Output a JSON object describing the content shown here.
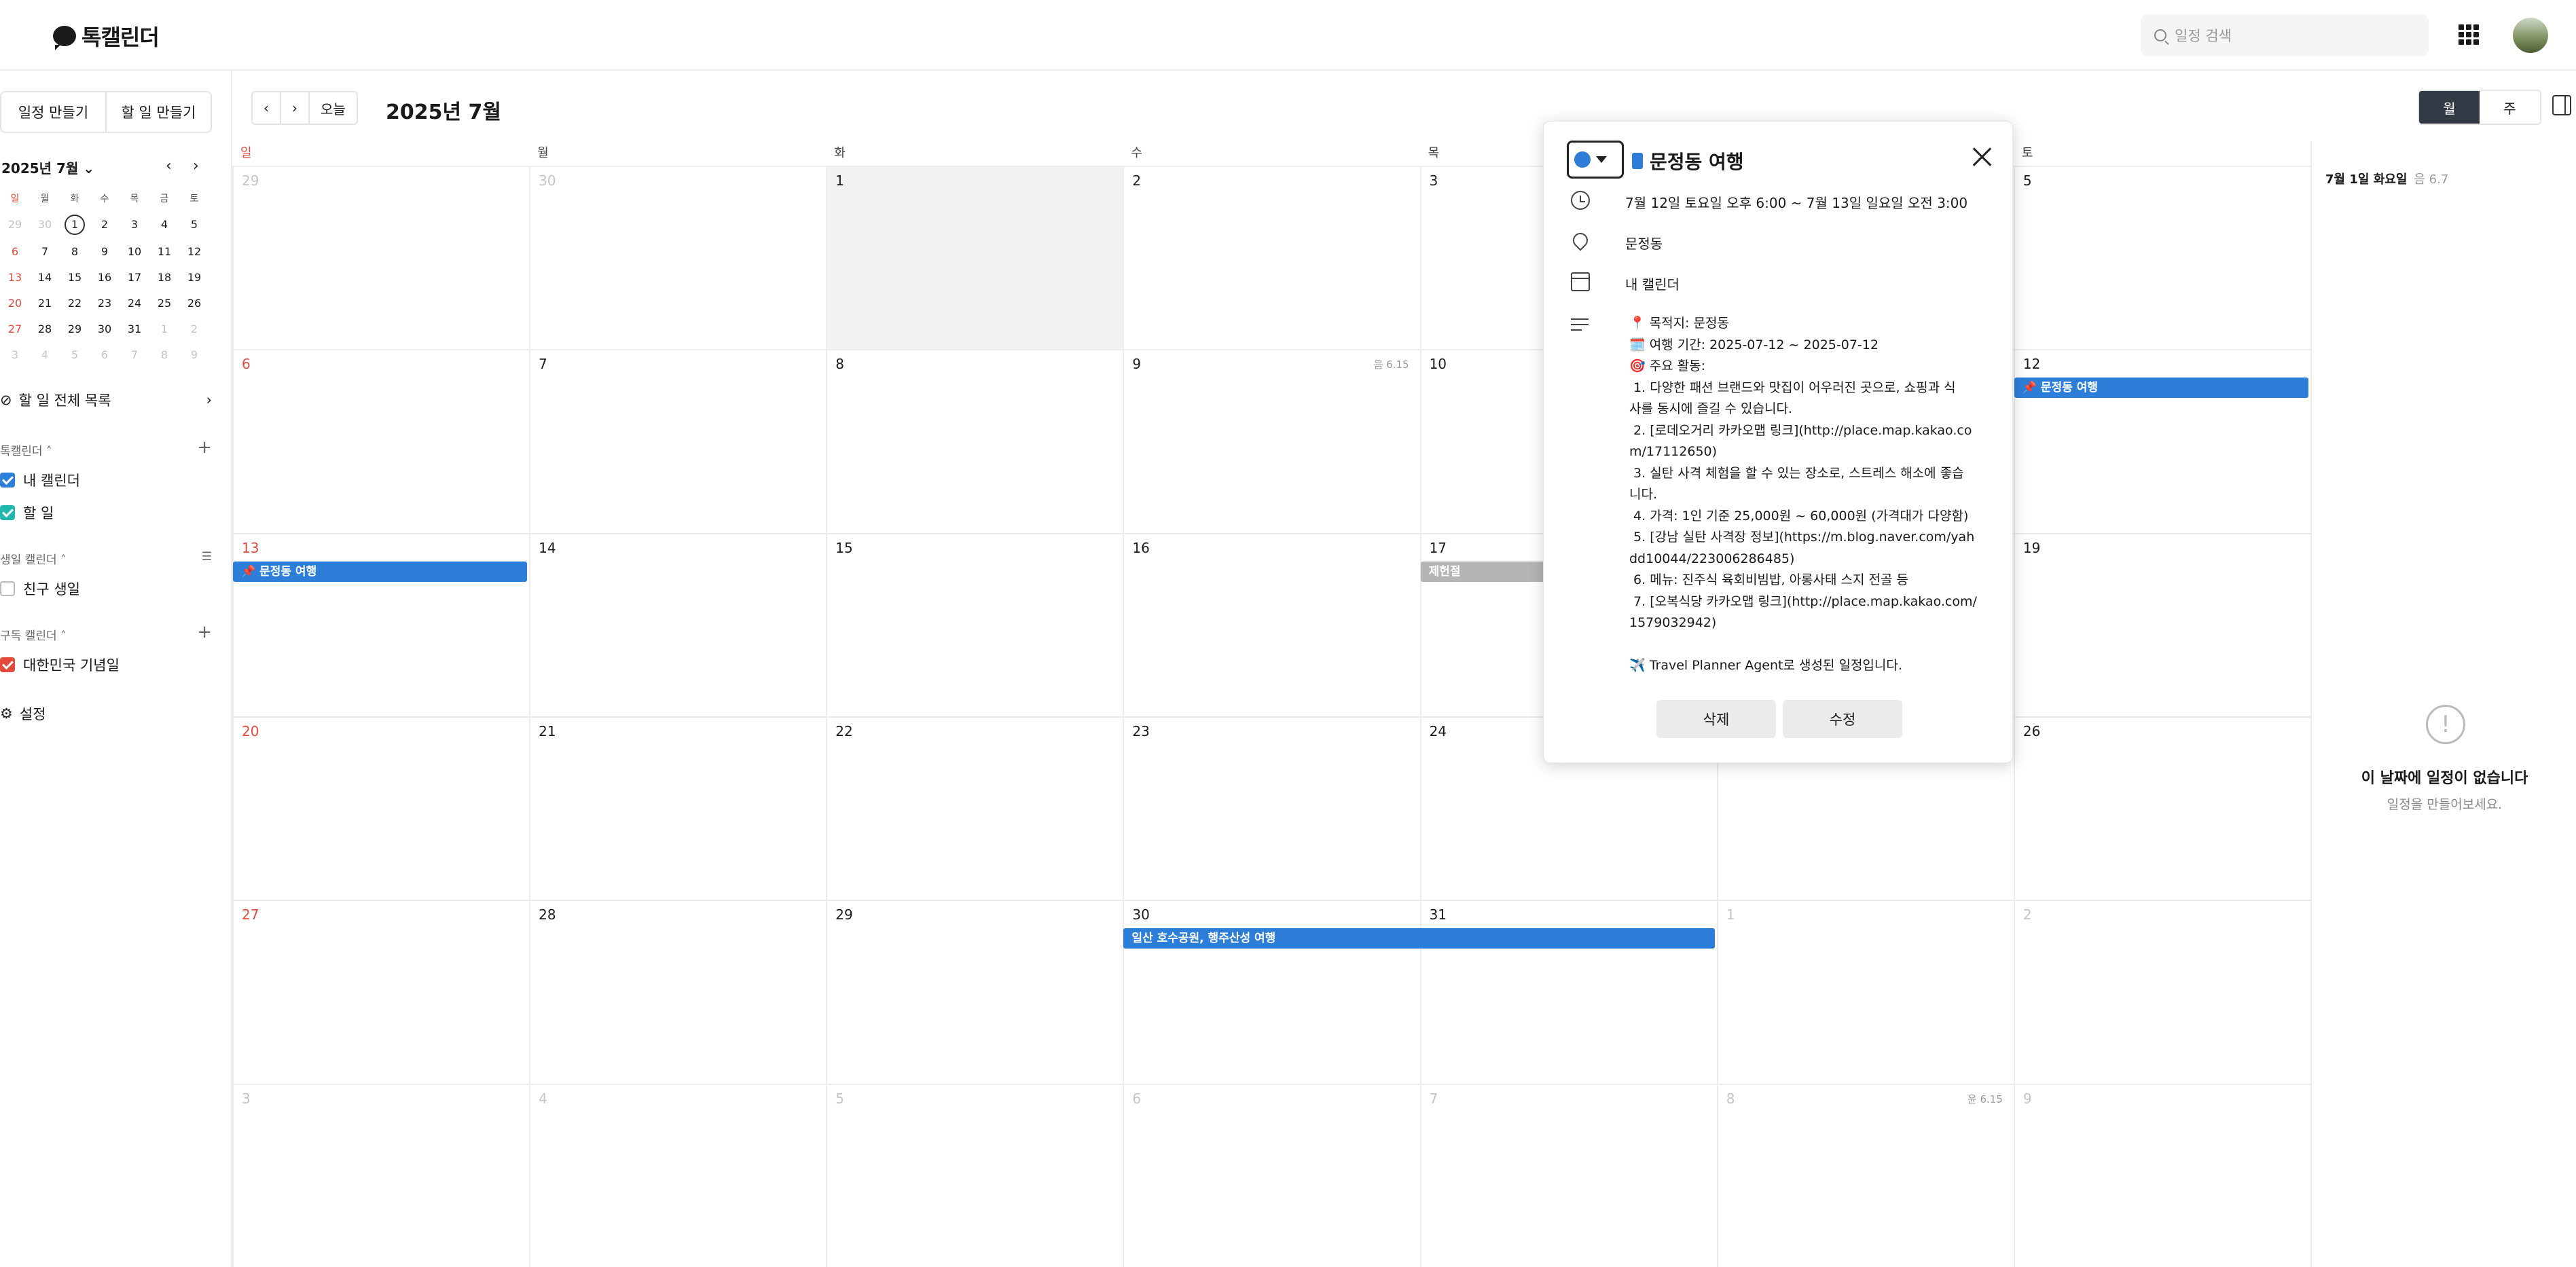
{
  "app": {
    "title": "톡캘린더"
  },
  "search": {
    "placeholder": "일정 검색"
  },
  "sidebar": {
    "create_event": "일정 만들기",
    "create_todo": "할 일 만들기",
    "mini_title": "2025년 7월",
    "weekdays": [
      "일",
      "월",
      "화",
      "수",
      "목",
      "금",
      "토"
    ],
    "weeks": [
      [
        "29",
        "30",
        "1",
        "2",
        "3",
        "4",
        "5"
      ],
      [
        "6",
        "7",
        "8",
        "9",
        "10",
        "11",
        "12"
      ],
      [
        "13",
        "14",
        "15",
        "16",
        "17",
        "18",
        "19"
      ],
      [
        "20",
        "21",
        "22",
        "23",
        "24",
        "25",
        "26"
      ],
      [
        "27",
        "28",
        "29",
        "30",
        "31",
        "1",
        "2"
      ],
      [
        "3",
        "4",
        "5",
        "6",
        "7",
        "8",
        "9"
      ]
    ],
    "todo_all": "할 일 전체 목록",
    "talk_section": "톡캘린더",
    "my_calendar": "내 캘린더",
    "todo": "할 일",
    "birthday_section": "생일 캘린더",
    "friend_birthday": "친구 생일",
    "sub_section": "구독 캘린더",
    "holidays": "대한민국 기념일",
    "settings": "설정",
    "colors": {
      "my_calendar": "#2d7ed9",
      "todo": "#22b8b0",
      "holidays": "#e24b3b"
    }
  },
  "calendar": {
    "today_label": "오늘",
    "title": "2025년 7월",
    "views": [
      "월",
      "주"
    ],
    "weekday_headers": [
      "일",
      "월",
      "화",
      "수",
      "목",
      "금",
      "토"
    ],
    "weeks": [
      [
        {
          "d": "29",
          "out": true
        },
        {
          "d": "30",
          "out": true
        },
        {
          "d": "1",
          "today": true
        },
        {
          "d": "2"
        },
        {
          "d": "3"
        },
        {
          "d": "4"
        },
        {
          "d": "5"
        }
      ],
      [
        {
          "d": "6"
        },
        {
          "d": "7"
        },
        {
          "d": "8"
        },
        {
          "d": "9",
          "lunar": "음 6.15"
        },
        {
          "d": "10"
        },
        {
          "d": "11"
        },
        {
          "d": "12"
        }
      ],
      [
        {
          "d": "13"
        },
        {
          "d": "14"
        },
        {
          "d": "15"
        },
        {
          "d": "16"
        },
        {
          "d": "17"
        },
        {
          "d": "18"
        },
        {
          "d": "19"
        }
      ],
      [
        {
          "d": "20"
        },
        {
          "d": "21"
        },
        {
          "d": "22"
        },
        {
          "d": "23"
        },
        {
          "d": "24"
        },
        {
          "d": "25"
        },
        {
          "d": "26"
        }
      ],
      [
        {
          "d": "27"
        },
        {
          "d": "28"
        },
        {
          "d": "29"
        },
        {
          "d": "30"
        },
        {
          "d": "31"
        },
        {
          "d": "1",
          "out": true
        },
        {
          "d": "2",
          "out": true
        }
      ],
      [
        {
          "d": "3",
          "out": true
        },
        {
          "d": "4",
          "out": true
        },
        {
          "d": "5",
          "out": true
        },
        {
          "d": "6",
          "out": true
        },
        {
          "d": "7",
          "out": true
        },
        {
          "d": "8",
          "out": true,
          "lunar": "윤 6.15"
        },
        {
          "d": "9",
          "out": true
        }
      ]
    ],
    "events": [
      {
        "label": "📌 문정동 여행",
        "week": 1,
        "start": 6,
        "end": 6,
        "color": "#2d7ed9"
      },
      {
        "label": "📌 문정동 여행",
        "week": 2,
        "start": 0,
        "end": 0,
        "color": "#2d7ed9"
      },
      {
        "label": "제헌절",
        "week": 2,
        "start": 4,
        "end": 4,
        "color": "#b5b5b5"
      },
      {
        "label": "일산 호수공원, 행주산성 여행",
        "week": 4,
        "start": 3,
        "end": 4,
        "color": "#2d7ed9"
      }
    ]
  },
  "right_panel": {
    "date": "7월 1일 화요일",
    "lunar": "음 6.7",
    "empty_title": "이 날짜에 일정이 없습니다",
    "empty_sub": "일정을 만들어보세요."
  },
  "popup": {
    "color": "#2d7ed9",
    "title": "문정동 여행",
    "time": "7월 12일 토요일 오후 6:00 ~ 7월 13일 일요일 오전 3:00",
    "location": "문정동",
    "calendar": "내 캘린더",
    "description": [
      "📍 목적지: 문정동",
      "🗓️ 여행 기간: 2025-07-12 ~ 2025-07-12",
      "🎯 주요 활동:",
      " 1. 다양한 패션 브랜드와 맛집이 어우러진 곳으로, 쇼핑과 식",
      "사를 동시에 즐길 수 있습니다.",
      " 2. [로데오거리 카카오맵 링크](http://place.map.kakao.co",
      "m/17112650)",
      " 3. 실탄 사격 체험을 할 수 있는 장소로, 스트레스 해소에 좋습",
      "니다.",
      " 4. 가격: 1인 기준 25,000원 ~ 60,000원 (가격대가 다양함)",
      " 5. [강남 실탄 사격장 정보](https://m.blog.naver.com/yah",
      "dd10044/223006286485)",
      " 6. 메뉴: 진주식 육회비빔밥, 아롱사태 스지 전골 등",
      " 7. [오복식당 카카오맵 링크](http://place.map.kakao.com/",
      "1579032942)",
      "",
      "✈️ Travel Planner Agent로 생성된 일정입니다."
    ],
    "delete": "삭제",
    "edit": "수정"
  }
}
